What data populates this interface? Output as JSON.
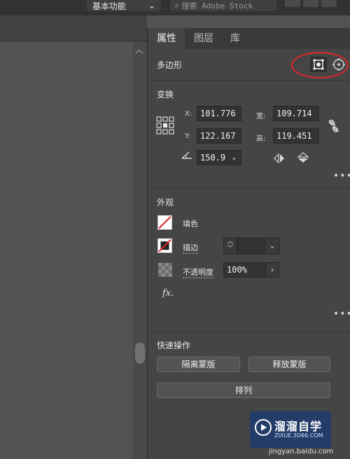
{
  "topbar": {
    "workspace_label": "基本功能",
    "search_placeholder": "搜索 Adobe Stock"
  },
  "panel": {
    "tabs": [
      "属性",
      "图层",
      "库"
    ],
    "object_type": "多边形",
    "transform": {
      "title": "变换",
      "x_label": "X:",
      "x_value": "101.776",
      "y_label": "Y:",
      "y_value": "122.167",
      "w_label": "宽:",
      "w_value": "109.714",
      "h_label": "高:",
      "h_value": "119.451",
      "angle_value": "150.9"
    },
    "appearance": {
      "title": "外观",
      "fill_label": "填色",
      "stroke_label": "描边",
      "opacity_label": "不透明度",
      "opacity_value": "100%",
      "fx_label": "fx."
    },
    "quick_actions": {
      "title": "快速操作",
      "isolate_label": "隔离蒙版",
      "release_label": "释放蒙版",
      "arrange_label": "排列"
    }
  },
  "watermark": {
    "title": "溜溜自学",
    "subtitle": "ZIXUE.3D66.COM",
    "url": "jingyan.baidu.com"
  },
  "colors": {
    "annotation_circle": "#e0262b",
    "panel_bg": "#454545",
    "canvas_bg": "#535353"
  }
}
